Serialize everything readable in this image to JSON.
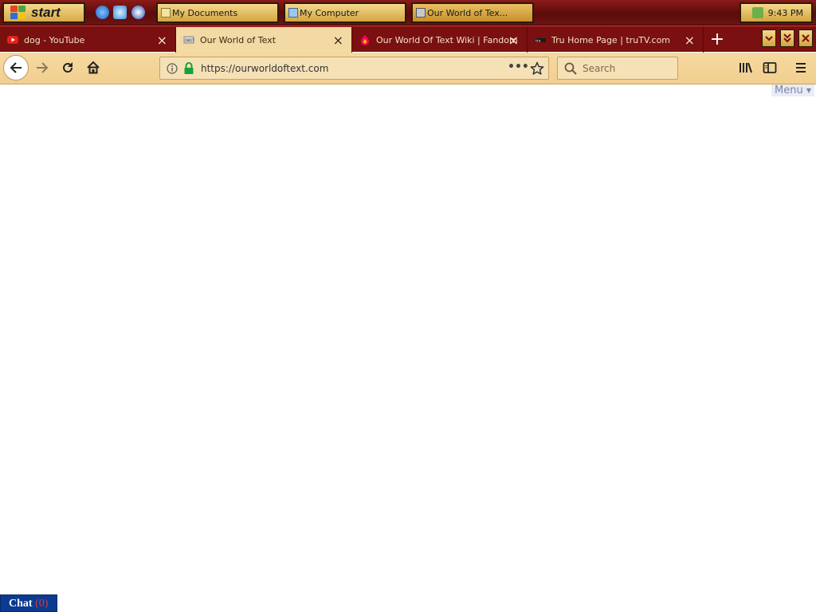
{
  "taskbar": {
    "start_label": "start",
    "windows": [
      {
        "label": "My Documents"
      },
      {
        "label": "My Computer"
      },
      {
        "label": "Our World of Tex..."
      }
    ],
    "clock": "9:43 PM"
  },
  "browser": {
    "tabs": [
      {
        "label": "dog - YouTube",
        "favicon": "youtube-icon"
      },
      {
        "label": "Our World of Text",
        "favicon": "owot-icon"
      },
      {
        "label": "Our World Of Text Wiki | Fandom",
        "favicon": "fandom-icon"
      },
      {
        "label": "Tru Home Page | truTV.com",
        "favicon": "trutv-icon"
      }
    ],
    "url": "https://ourworldoftext.com",
    "search_placeholder": "Search"
  },
  "page": {
    "menu_label": "Menu",
    "chat_label": "Chat",
    "chat_count": "(0)"
  },
  "colors": {
    "taskbar": "#7a1010",
    "accent_gold": "#f3d98d",
    "chat_blue": "#0b3b91"
  }
}
